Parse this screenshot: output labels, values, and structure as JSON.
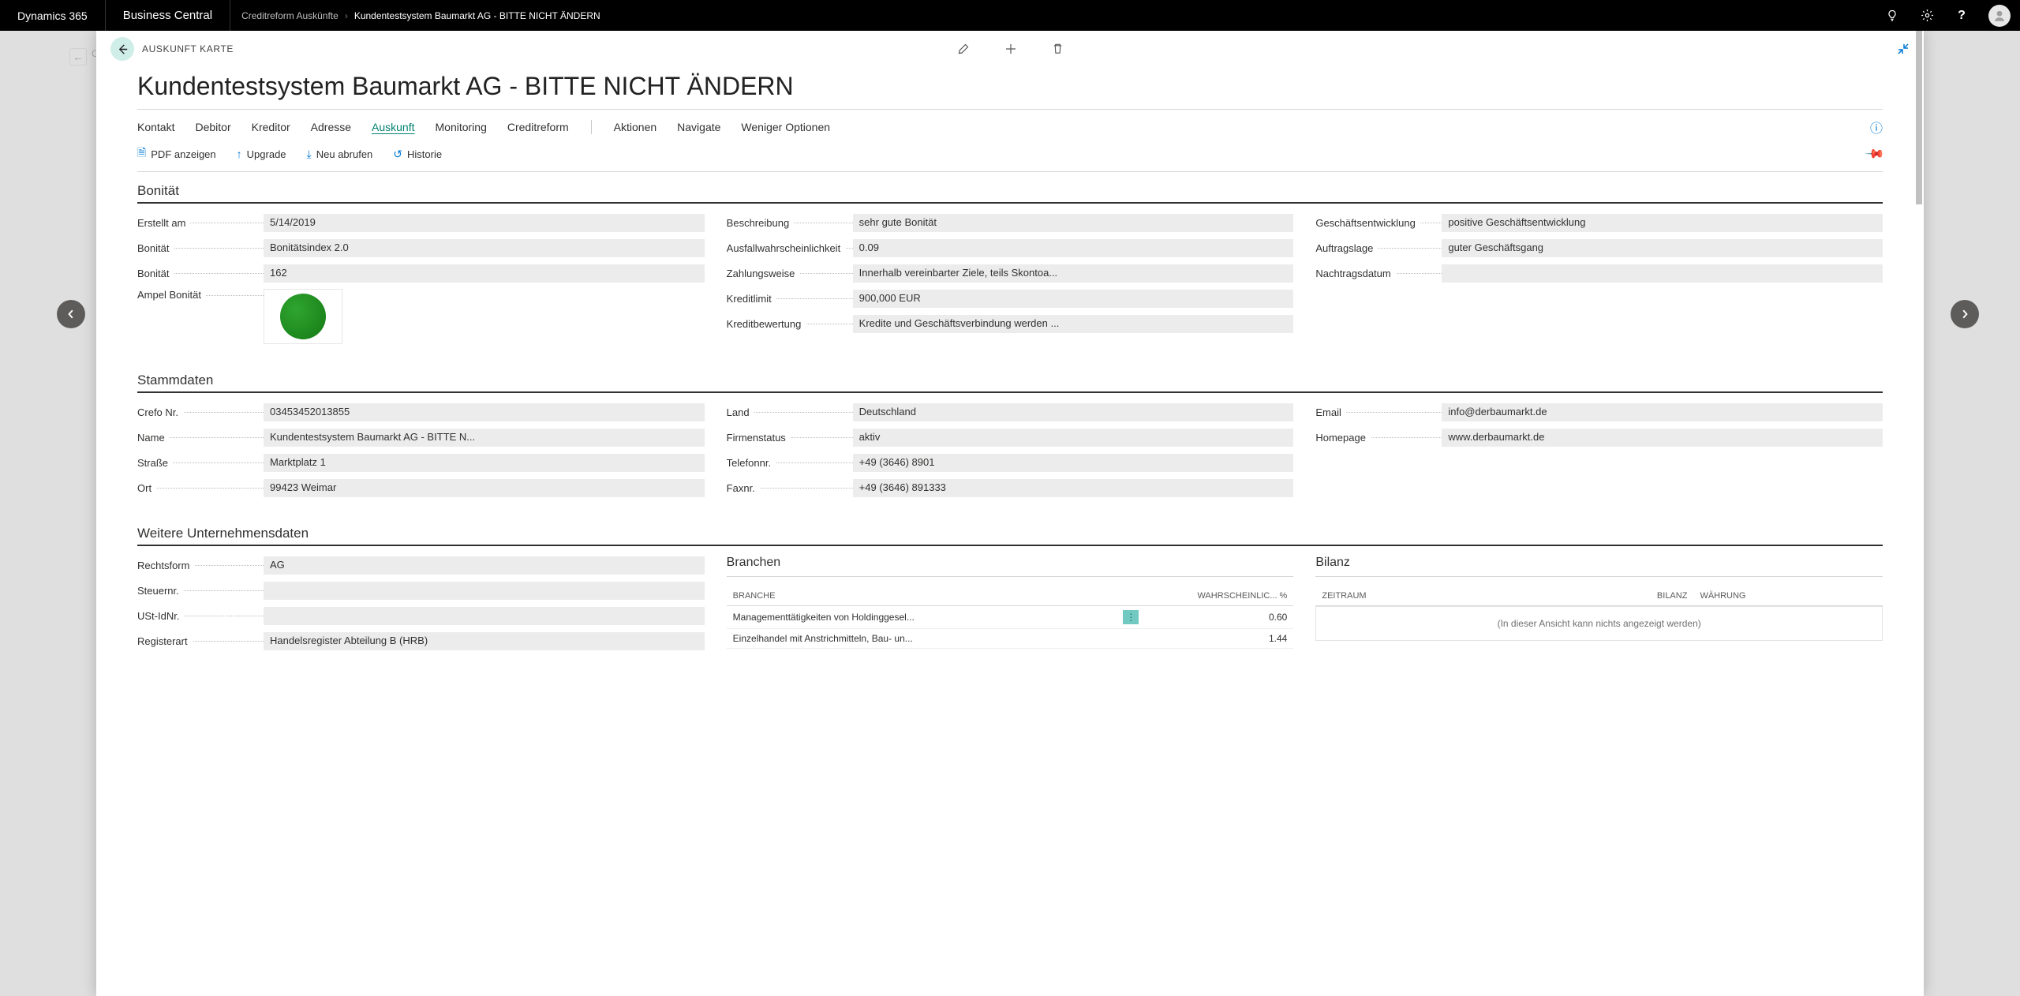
{
  "topbar": {
    "product": "Dynamics 365",
    "app": "Business Central",
    "crumb1": "Creditreform Auskünfte",
    "crumb2": "Kundentestsystem Baumarkt AG - BITTE NICHT ÄNDERN"
  },
  "header": {
    "card_label": "AUSKUNFT KARTE",
    "title": "Kundentestsystem Baumarkt AG - BITTE NICHT ÄNDERN"
  },
  "tabs": {
    "kontakt": "Kontakt",
    "debitor": "Debitor",
    "kreditor": "Kreditor",
    "adresse": "Adresse",
    "auskunft": "Auskunft",
    "monitoring": "Monitoring",
    "creditreform": "Creditreform",
    "aktionen": "Aktionen",
    "navigate": "Navigate",
    "weniger": "Weniger Optionen"
  },
  "actions": {
    "pdf": "PDF anzeigen",
    "upgrade": "Upgrade",
    "neu": "Neu abrufen",
    "historie": "Historie"
  },
  "sections": {
    "bonitaet": "Bonität",
    "stammdaten": "Stammdaten",
    "weitere": "Weitere Unternehmensdaten",
    "branchen": "Branchen",
    "bilanz": "Bilanz"
  },
  "bonitaet": {
    "labels": {
      "erstellt": "Erstellt am",
      "bonitaet1": "Bonität",
      "bonitaet2": "Bonität",
      "ampel": "Ampel Bonität",
      "beschreibung": "Beschreibung",
      "ausfall": "Ausfallwahrscheinlichkeit",
      "zahlungsweise": "Zahlungsweise",
      "kreditlimit": "Kreditlimit",
      "kreditbewertung": "Kreditbewertung",
      "geschaeft": "Geschäftsentwicklung",
      "auftragslage": "Auftragslage",
      "nachtrag": "Nachtragsdatum"
    },
    "values": {
      "erstellt": "5/14/2019",
      "bonitaet1": "Bonitätsindex 2.0",
      "bonitaet2": "162",
      "beschreibung": "sehr gute Bonität",
      "ausfall": "0.09",
      "zahlungsweise": "Innerhalb vereinbarter Ziele, teils Skontoa...",
      "kreditlimit": "900,000 EUR",
      "kreditbewertung": "Kredite und Geschäftsverbindung werden ...",
      "geschaeft": "positive Geschäftsentwicklung",
      "auftragslage": "guter Geschäftsgang",
      "nachtrag": ""
    }
  },
  "stammdaten": {
    "labels": {
      "crefo": "Crefo Nr.",
      "name": "Name",
      "strasse": "Straße",
      "ort": "Ort",
      "land": "Land",
      "firmenstatus": "Firmenstatus",
      "telefon": "Telefonnr.",
      "fax": "Faxnr.",
      "email": "Email",
      "homepage": "Homepage"
    },
    "values": {
      "crefo": "03453452013855",
      "name": "Kundentestsystem Baumarkt AG - BITTE N...",
      "strasse": "Marktplatz 1",
      "ort": "99423 Weimar",
      "land": "Deutschland",
      "firmenstatus": "aktiv",
      "telefon": "+49 (3646) 8901",
      "fax": "+49 (3646) 891333",
      "email": "info@derbaumarkt.de",
      "homepage": "www.derbaumarkt.de"
    }
  },
  "weitere": {
    "labels": {
      "rechtsform": "Rechtsform",
      "steuer": "Steuernr.",
      "ust": "USt-IdNr.",
      "reg": "Registerart"
    },
    "values": {
      "rechtsform": "AG",
      "steuer": "",
      "ust": "",
      "reg": "Handelsregister Abteilung B (HRB)"
    }
  },
  "branchen": {
    "headers": {
      "branche": "BRANCHE",
      "pct": "WAHRSCHEINLIC... %"
    },
    "rows": [
      {
        "name": "Managementtätigkeiten von Holdinggesel...",
        "pct": "0.60"
      },
      {
        "name": "Einzelhandel mit Anstrichmitteln, Bau- un...",
        "pct": "1.44"
      }
    ]
  },
  "bilanz": {
    "headers": {
      "zeitraum": "ZEITRAUM",
      "bilanz": "BILANZ",
      "waehrung": "WÄHRUNG"
    },
    "empty": "(In dieser Ansicht kann nichts angezeigt werden)"
  }
}
